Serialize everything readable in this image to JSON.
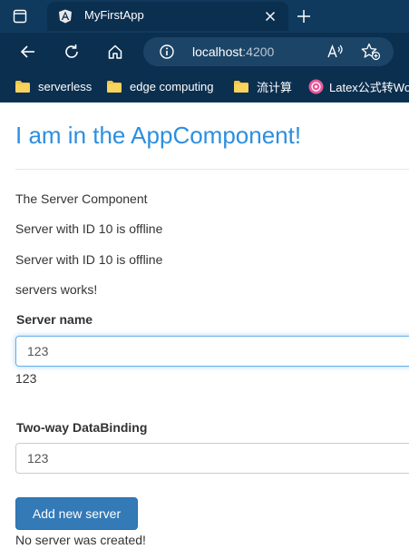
{
  "tab": {
    "title": "MyFirstApp"
  },
  "address_bar": {
    "host": "localhost",
    "port": ":4200"
  },
  "bookmarks": [
    {
      "label": "serverless",
      "icon": "folder-icon"
    },
    {
      "label": "edge computing",
      "icon": "folder-icon"
    },
    {
      "label": "流计算",
      "icon": "folder-icon"
    },
    {
      "label": "Latex公式转Wo",
      "icon": "site-favicon-icon"
    }
  ],
  "page": {
    "heading": "I am in the AppComponent!",
    "server_component_text": "The Server Component",
    "server_status_1": "Server with ID 10 is offline",
    "server_status_2": "Server with ID 10 is offline",
    "servers_works_text": "servers works!",
    "server_name_label": "Server name",
    "server_name_value": "123",
    "server_name_echo": "123",
    "two_way_label": "Two-way DataBinding",
    "two_way_value": "123",
    "add_button_label": "Add new server",
    "creation_status": "No server was created!"
  },
  "colors": {
    "browser_chrome": "#0b2f4f",
    "heading": "#2c8fe0",
    "primary_button": "#337ab7",
    "focus_ring": "#66afe9"
  }
}
